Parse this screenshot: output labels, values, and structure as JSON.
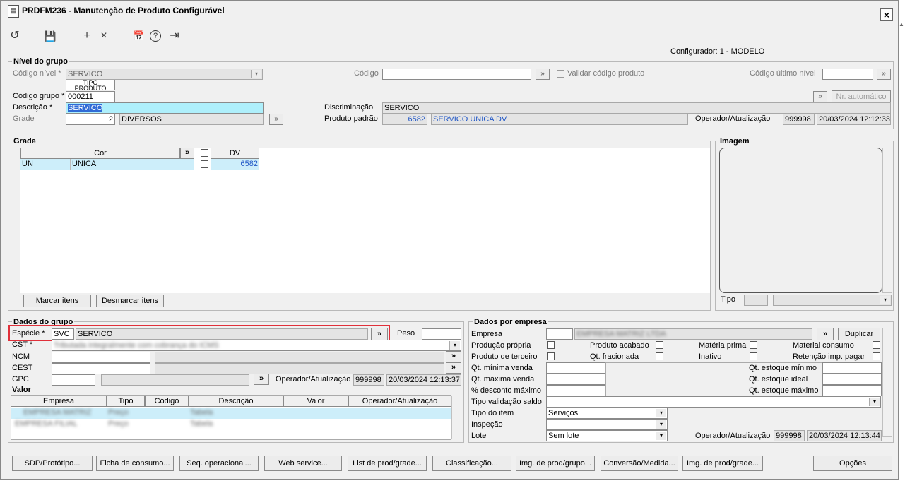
{
  "window": {
    "title": "PRDFM236 - Manutenção de Produto Configurável",
    "close_label": "×"
  },
  "toolbar": {
    "refresh": "↺",
    "save": "💾",
    "add": "+",
    "delete": "×",
    "calendar": "📅",
    "help": "?",
    "exit": "⇥"
  },
  "configurador": "Configurador: 1 - MODELO",
  "nivel": {
    "section_title": "Nível do grupo",
    "codigo_nivel_label": "Código nível *",
    "codigo_nivel_value": "SERVICO",
    "tipo_produto_hint": "TIPO PRODUTO",
    "codigo_label": "Código",
    "validar_label": "Validar código produto",
    "codigo_ultimo_label": "Código último nível",
    "codigo_grupo_label": "Código grupo *",
    "codigo_grupo_value": "000211",
    "nr_automatico_label": "Nr. automático",
    "descricao_label": "Descrição *",
    "descricao_value": "SERVICO",
    "discriminacao_label": "Discriminação",
    "discriminacao_value": "SERVICO",
    "grade_label": "Grade",
    "grade_num": "2",
    "grade_desc": "DIVERSOS",
    "produto_padrao_label": "Produto padrão",
    "produto_padrao_code": "6582",
    "produto_padrao_desc": "SERVICO UNICA DV",
    "operador_label": "Operador/Atualização",
    "operador_value": "999998",
    "operador_date": "20/03/2024 12:12:33"
  },
  "grade": {
    "section_title": "Grade",
    "col_cor": "Cor",
    "col_dv": "DV",
    "row_code": "UN",
    "row_desc": "UNICA",
    "row_dv": "6582",
    "marcar_label": "Marcar itens",
    "desmarcar_label": "Desmarcar itens"
  },
  "imagem": {
    "section_title": "Imagem",
    "tipo_label": "Tipo"
  },
  "dados_grupo": {
    "section_title": "Dados do grupo",
    "especie_label": "Espécie *",
    "especie_code": "SVC",
    "especie_desc": "SERVICO",
    "peso_label": "Peso",
    "cst_label": "CST *",
    "cst_value": "Tributada integralmente com cobrança do ICMS",
    "ncm_label": "NCM",
    "cest_label": "CEST",
    "gpc_label": "GPC",
    "operador_label": "Operador/Atualização",
    "operador_value": "999998",
    "operador_date": "20/03/2024 12:13:37"
  },
  "valor": {
    "section_title": "Valor",
    "cols": [
      "Empresa",
      "Tipo",
      "Código",
      "Descrição",
      "Valor",
      "Operador/Atualização"
    ],
    "rows": [
      [
        "EMPRESA MATRIZ",
        "Preço",
        "",
        "Tabela",
        "",
        ""
      ],
      [
        "EMPRESA FILIAL",
        "Preço",
        "",
        "Tabela",
        "",
        ""
      ]
    ]
  },
  "dados_empresa": {
    "section_title": "Dados por empresa",
    "empresa_label": "Empresa",
    "empresa_value": "EMPRESA MATRIZ LTDA",
    "duplicar_label": "Duplicar",
    "producao_propria": "Produção própria",
    "produto_acabado": "Produto acabado",
    "materia_prima": "Matéria prima",
    "material_consumo": "Material consumo",
    "produto_terceiro": "Produto de terceiro",
    "qt_fracionada": "Qt. fracionada",
    "inativo": "Inativo",
    "retencao": "Retenção imp. pagar",
    "qt_min_venda": "Qt. mínima venda",
    "qt_max_venda": "Qt. máxima venda",
    "desconto_max": "% desconto máximo",
    "qt_estoque_min": "Qt. estoque mínimo",
    "qt_estoque_ideal": "Qt. estoque ideal",
    "qt_estoque_max": "Qt. estoque máximo",
    "tipo_validacao": "Tipo validação saldo",
    "tipo_item_label": "Tipo do item",
    "tipo_item_value": "Serviços",
    "inspecao_label": "Inspeção",
    "lote_label": "Lote",
    "lote_value": "Sem lote",
    "operador_label": "Operador/Atualização",
    "operador_value": "999998",
    "operador_date": "20/03/2024 12:13:44"
  },
  "bottom_buttons": [
    "SDP/Protótipo...",
    "Ficha de consumo...",
    "Seq. operacional...",
    "Web service...",
    "List de prod/grade...",
    "Classificação...",
    "Img. de prod/grupo...",
    "Conversão/Medida...",
    "Img. de prod/grade...",
    "Opções"
  ],
  "colors": {
    "highlight": "#aeeffb",
    "accent_red": "#e0303a",
    "link_blue": "#1f56c6"
  }
}
